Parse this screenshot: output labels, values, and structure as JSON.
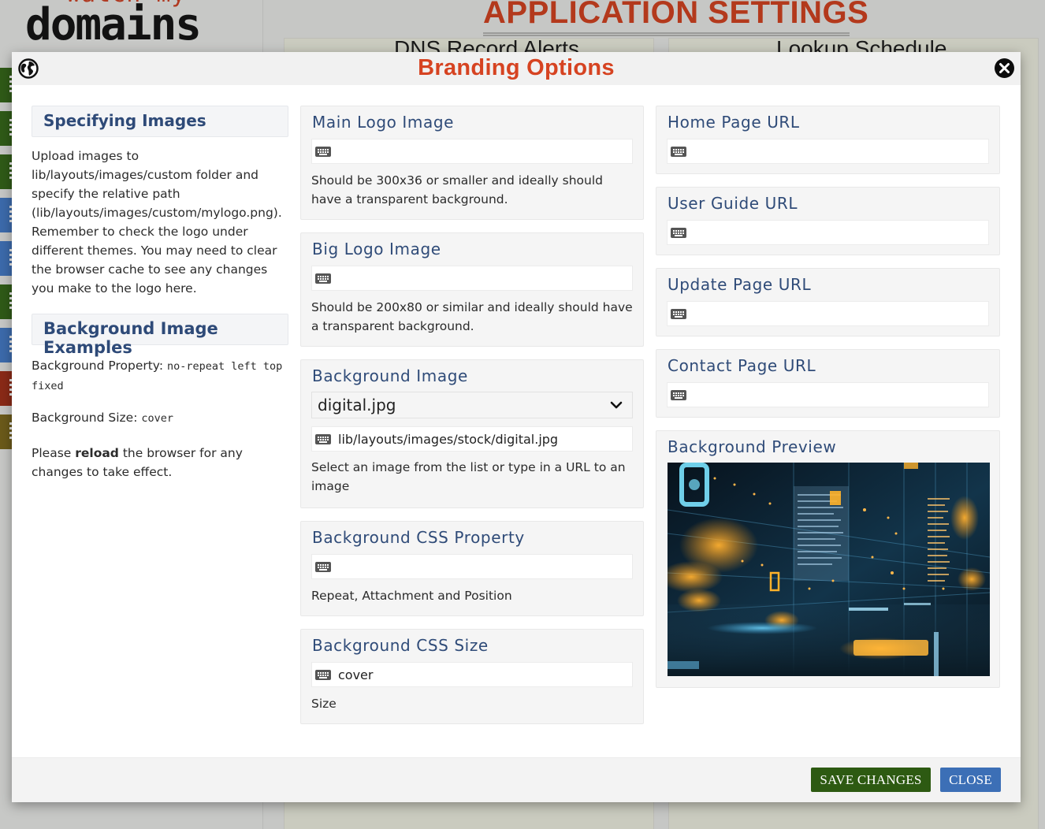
{
  "background_page": {
    "logo_top": "watch my",
    "logo_bottom": "domains",
    "title": "APPLICATION SETTINGS",
    "card_1_title": "DNS Record Alerts",
    "card_2_title": "Lookup Schedule",
    "stripe_colors": [
      "#2f5a17",
      "#2f5a17",
      "#2f5a17",
      "#3c6aab",
      "#3c6aab",
      "#2f5a17",
      "#3c6aab",
      "#8a2a17",
      "#6b5a1a"
    ]
  },
  "modal": {
    "title": "Branding Options",
    "info": {
      "heading_1": "Specifying Images",
      "paragraph_1": "Upload images to lib/layouts/images/custom folder and specify the relative path (lib/layouts/images/custom/mylogo.png). Remember to check the logo under different themes. You may need to clear the browser cache to see any changes you make to the logo here.",
      "heading_2": "Background Image Examples",
      "bg_property_label": "Background Property: ",
      "bg_property_value": "no-repeat left top fixed",
      "bg_size_label": "Background Size: ",
      "bg_size_value": "cover",
      "reload_pre": "Please ",
      "reload_bold": "reload",
      "reload_post": " the browser for any changes to take effect."
    },
    "fields": {
      "main_logo": {
        "label": "Main Logo Image",
        "value": "",
        "help": "Should be 300x36 or smaller and ideally should have a transparent background."
      },
      "big_logo": {
        "label": "Big Logo Image",
        "value": "",
        "help": "Should be 200x80 or similar and ideally should have a transparent background."
      },
      "background_image": {
        "label": "Background Image",
        "selected": "digital.jpg",
        "value": "lib/layouts/images/stock/digital.jpg",
        "help": "Select an image from the list or type in a URL to an image"
      },
      "background_css_property": {
        "label": "Background CSS Property",
        "value": "",
        "help": "Repeat, Attachment and Position"
      },
      "background_css_size": {
        "label": "Background CSS Size",
        "value": "cover",
        "help": "Size"
      },
      "home_page_url": {
        "label": "Home Page URL",
        "value": ""
      },
      "user_guide_url": {
        "label": "User Guide URL",
        "value": ""
      },
      "update_page_url": {
        "label": "Update Page URL",
        "value": ""
      },
      "contact_page_url": {
        "label": "Contact Page URL",
        "value": ""
      },
      "background_preview": {
        "label": "Background Preview"
      }
    },
    "buttons": {
      "save": "SAVE CHANGES",
      "close": "CLOSE"
    },
    "icons": {
      "header_left": "globe-icon",
      "header_right": "close-circle-icon",
      "field_prefix": "keyboard-icon",
      "select": "chevron-down-icon"
    },
    "colors": {
      "title": "#d64321",
      "label": "#2f4b78",
      "save_button": "#2d5a12",
      "close_button": "#3c6fb6"
    }
  }
}
